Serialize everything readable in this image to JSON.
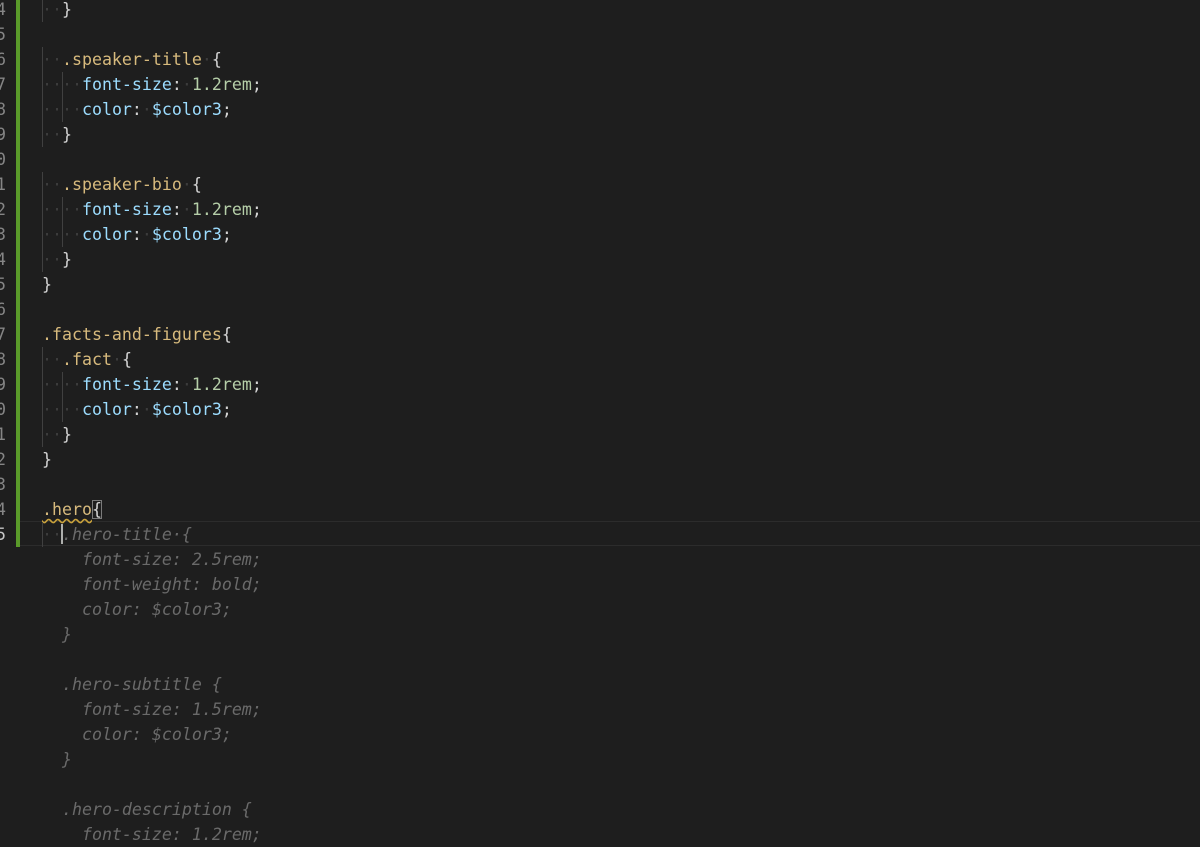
{
  "editor": {
    "language": "scss",
    "line_numbers": [
      "4",
      "5",
      "6",
      "7",
      "8",
      "9",
      "0",
      "1",
      "2",
      "3",
      "4",
      "5",
      "6",
      "7",
      "8",
      "9",
      "0",
      "1",
      "2",
      "3",
      "4",
      "5"
    ],
    "lines": [
      {
        "indent": "··",
        "parts": [
          {
            "t": "}",
            "c": "pun"
          }
        ]
      },
      {
        "indent": "",
        "parts": []
      },
      {
        "indent": "··",
        "parts": [
          {
            "t": ".speaker-title",
            "c": "sel"
          },
          {
            "t": "·",
            "c": "ws"
          },
          {
            "t": "{",
            "c": "pun"
          }
        ]
      },
      {
        "indent": "····",
        "parts": [
          {
            "t": "font-size",
            "c": "prop"
          },
          {
            "t": ":",
            "c": "pun"
          },
          {
            "t": "·",
            "c": "ws"
          },
          {
            "t": "1.2rem",
            "c": "val"
          },
          {
            "t": ";",
            "c": "pun"
          }
        ]
      },
      {
        "indent": "····",
        "parts": [
          {
            "t": "color",
            "c": "prop"
          },
          {
            "t": ":",
            "c": "pun"
          },
          {
            "t": "·",
            "c": "ws"
          },
          {
            "t": "$color3",
            "c": "var"
          },
          {
            "t": ";",
            "c": "pun"
          }
        ]
      },
      {
        "indent": "··",
        "parts": [
          {
            "t": "}",
            "c": "pun"
          }
        ]
      },
      {
        "indent": "",
        "parts": []
      },
      {
        "indent": "··",
        "parts": [
          {
            "t": ".speaker-bio",
            "c": "sel"
          },
          {
            "t": "·",
            "c": "ws"
          },
          {
            "t": "{",
            "c": "pun"
          }
        ]
      },
      {
        "indent": "····",
        "parts": [
          {
            "t": "font-size",
            "c": "prop"
          },
          {
            "t": ":",
            "c": "pun"
          },
          {
            "t": "·",
            "c": "ws"
          },
          {
            "t": "1.2rem",
            "c": "val"
          },
          {
            "t": ";",
            "c": "pun"
          }
        ]
      },
      {
        "indent": "····",
        "parts": [
          {
            "t": "color",
            "c": "prop"
          },
          {
            "t": ":",
            "c": "pun"
          },
          {
            "t": "·",
            "c": "ws"
          },
          {
            "t": "$color3",
            "c": "var"
          },
          {
            "t": ";",
            "c": "pun"
          }
        ]
      },
      {
        "indent": "··",
        "parts": [
          {
            "t": "}",
            "c": "pun"
          }
        ]
      },
      {
        "indent": "",
        "parts": [
          {
            "t": "}",
            "c": "pun"
          }
        ]
      },
      {
        "indent": "",
        "parts": []
      },
      {
        "indent": "",
        "parts": [
          {
            "t": ".facts-and-figures",
            "c": "sel"
          },
          {
            "t": "{",
            "c": "pun"
          }
        ]
      },
      {
        "indent": "··",
        "parts": [
          {
            "t": ".fact",
            "c": "sel"
          },
          {
            "t": "·",
            "c": "ws"
          },
          {
            "t": "{",
            "c": "pun"
          }
        ]
      },
      {
        "indent": "····",
        "parts": [
          {
            "t": "font-size",
            "c": "prop"
          },
          {
            "t": ":",
            "c": "pun"
          },
          {
            "t": "·",
            "c": "ws"
          },
          {
            "t": "1.2rem",
            "c": "val"
          },
          {
            "t": ";",
            "c": "pun"
          }
        ]
      },
      {
        "indent": "····",
        "parts": [
          {
            "t": "color",
            "c": "prop"
          },
          {
            "t": ":",
            "c": "pun"
          },
          {
            "t": "·",
            "c": "ws"
          },
          {
            "t": "$color3",
            "c": "var"
          },
          {
            "t": ";",
            "c": "pun"
          }
        ]
      },
      {
        "indent": "··",
        "parts": [
          {
            "t": "}",
            "c": "pun"
          }
        ]
      },
      {
        "indent": "",
        "parts": [
          {
            "t": "}",
            "c": "pun"
          }
        ]
      },
      {
        "indent": "",
        "parts": []
      },
      {
        "indent": "",
        "parts": [
          {
            "t": ".hero",
            "c": "sel squiggle"
          },
          {
            "t": "{",
            "c": "pun hero-brace"
          }
        ]
      },
      {
        "indent": "··",
        "parts": [
          {
            "t": ".hero-title·{",
            "c": "ghost"
          }
        ]
      }
    ],
    "ghost_lines": [
      "    font-size: 2.5rem;",
      "    font-weight: bold;",
      "    color: $color3;",
      "  }",
      "",
      "  .hero-subtitle {",
      "    font-size: 1.5rem;",
      "    color: $color3;",
      "  }",
      "",
      "  .hero-description {",
      "    font-size: 1.2rem;"
    ],
    "active_line_index": 21,
    "colors": {
      "background": "#1e1e1e",
      "selector": "#d7ba7d",
      "property": "#9cdcfe",
      "value": "#b5cea8",
      "ghost_text": "#6a6a6a",
      "modified_bar": "#5a9a2a"
    }
  }
}
